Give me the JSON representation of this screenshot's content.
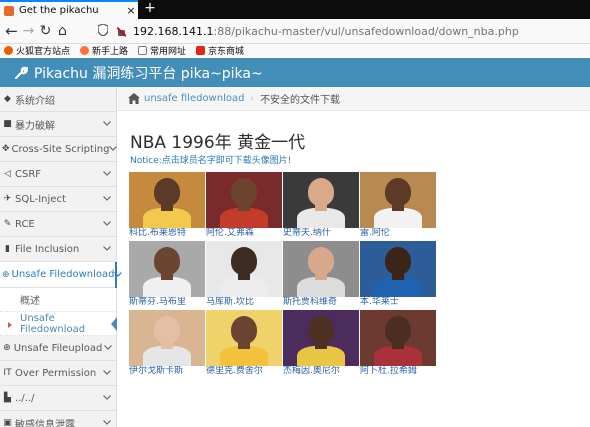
{
  "browser": {
    "tab_title": "Get the pikachu",
    "tab_close": "×",
    "new_tab": "+",
    "url_host": "192.168.141.1",
    "url_rest": ":88/pikachu-master/vul/unsafedownload/down_nba.php",
    "bookmarks": [
      {
        "label": "火狐官方站点",
        "color": "#e66000"
      },
      {
        "label": "新手上路",
        "color": "#ff7139"
      },
      {
        "label": "常用网址",
        "color": "#7a7a7a"
      },
      {
        "label": "京东商城",
        "color": "#e1251b"
      }
    ]
  },
  "app": {
    "title": "Pikachu 漏洞练习平台 pika~pika~"
  },
  "sidebar": {
    "items": [
      {
        "icon": "tag-icon",
        "glyph": "◆",
        "label": "系统介绍",
        "chevron": false
      },
      {
        "icon": "lock-icon",
        "glyph": "■",
        "label": "暴力破解",
        "chevron": true
      },
      {
        "icon": "code-icon",
        "glyph": "✥",
        "label": "Cross-Site Scripting",
        "chevron": true
      },
      {
        "icon": "share-icon",
        "glyph": "◁",
        "label": "CSRF",
        "chevron": true
      },
      {
        "icon": "fighter-icon",
        "glyph": "✈",
        "label": "SQL-Inject",
        "chevron": true
      },
      {
        "icon": "pencil-icon",
        "glyph": "✎",
        "label": "RCE",
        "chevron": true
      },
      {
        "icon": "file-icon",
        "glyph": "▮",
        "label": "File Inclusion",
        "chevron": true
      },
      {
        "icon": "download-icon",
        "glyph": "⊕",
        "label": "Unsafe Filedownload",
        "chevron": true,
        "active": true
      },
      {
        "icon": "upload-icon",
        "glyph": "⊕",
        "label": "Unsafe Fileupload",
        "chevron": true
      },
      {
        "icon": "text-height-icon",
        "glyph": "IT",
        "label": "Over Permission",
        "chevron": true
      },
      {
        "icon": "bar-chart-icon",
        "glyph": "▙",
        "label": "../../",
        "chevron": true
      },
      {
        "icon": "trash-icon",
        "glyph": "▣",
        "label": "敏感信息泄露",
        "chevron": true
      }
    ],
    "subitems": [
      {
        "label": "概述",
        "current": false
      },
      {
        "label": "Unsafe Filedownload",
        "current": true
      }
    ]
  },
  "breadcrumb": {
    "link": "unsafe filedownload",
    "separator": "›",
    "current": "不安全的文件下载"
  },
  "content": {
    "title": "NBA 1996年 黄金一代",
    "notice": "Notice:点击球员名字即可下载头像图片!"
  },
  "players": [
    {
      "name": "科比.布莱恩特",
      "bg": "#c58a3d",
      "skin": "#5a3a28",
      "jersey": "#f2c94c"
    },
    {
      "name": "阿伦.艾弗森",
      "bg": "#7a2a2a",
      "skin": "#6b4430",
      "jersey": "#c23b2b"
    },
    {
      "name": "史蒂夫.纳什",
      "bg": "#3a3a3a",
      "skin": "#d9a98a",
      "jersey": "#e8e8e8"
    },
    {
      "name": "雷.阿伦",
      "bg": "#b88a52",
      "skin": "#5d3a26",
      "jersey": "#f2f2f2"
    },
    {
      "name": "斯蒂芬.马布里",
      "bg": "#a9a9a9",
      "skin": "#6a4532",
      "jersey": "#f0f0f0"
    },
    {
      "name": "马库斯.坎比",
      "bg": "#e8e8e8",
      "skin": "#3d2a20",
      "jersey": "#ededed"
    },
    {
      "name": "斯托贾科维奇",
      "bg": "#8d8d8d",
      "skin": "#d8a88c",
      "jersey": "#dcdcdc"
    },
    {
      "name": "本.华莱士",
      "bg": "#2c5d98",
      "skin": "#3b2519",
      "jersey": "#1e63b0"
    },
    {
      "name": "伊尔戈斯卡斯",
      "bg": "#d9b591",
      "skin": "#e4bfa5",
      "jersey": "#e6e6e6"
    },
    {
      "name": "德里克.费舍尔",
      "bg": "#f0d26b",
      "skin": "#6b4331",
      "jersey": "#f3c23c"
    },
    {
      "name": "杰梅因.奥尼尔",
      "bg": "#4b2c5d",
      "skin": "#4d3022",
      "jersey": "#e8c542"
    },
    {
      "name": "阿卜杜.拉希姆",
      "bg": "#6c3a30",
      "skin": "#4a2e22",
      "jersey": "#a8313a"
    }
  ]
}
